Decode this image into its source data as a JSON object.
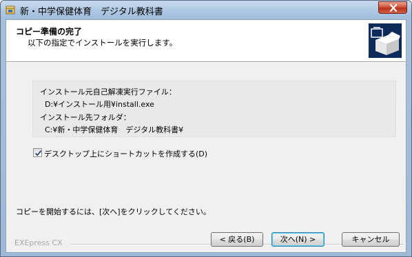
{
  "window": {
    "title": "新・中学保健体育　デジタル教科書"
  },
  "header": {
    "title": "コピー準備の完了",
    "subtitle": "以下の指定でインストールを実行します。"
  },
  "info": {
    "source_label": "インストール元自己解凍実行ファイル：",
    "source_value": "D:¥インストール用¥install.exe",
    "dest_label": "インストール先フォルダ：",
    "dest_value": "C:¥新・中学保健体育　デジタル教科書¥"
  },
  "shortcut": {
    "label": "デスクトップ上にショートカットを作成する(D)",
    "checked": true
  },
  "instruction": "コピーを開始するには、[次へ]をクリックしてください。",
  "brand": "EXEpress CX",
  "buttons": {
    "back": "< 戻る(B)",
    "next": "次へ(N) >",
    "cancel": "キャンセル"
  },
  "icons": {
    "app": "installer-app-icon",
    "header": "box-computer-icon",
    "close": "close-icon"
  }
}
